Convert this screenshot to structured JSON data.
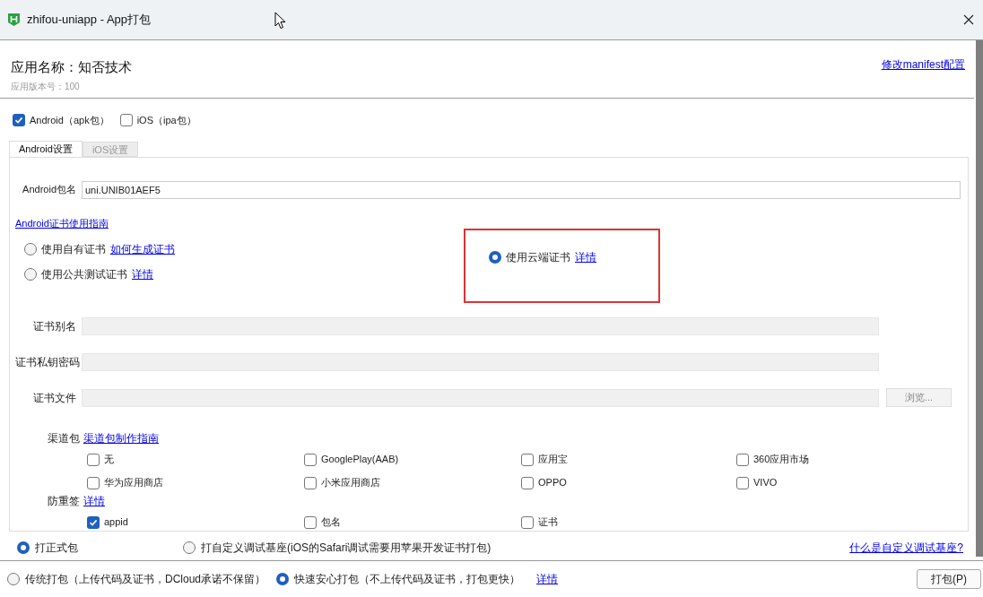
{
  "window": {
    "title": "zhifou-uniapp - App打包"
  },
  "header": {
    "app_name": "应用名称：知否技术",
    "version": "应用版本号：100",
    "manifest_link": "修改manifest配置"
  },
  "platforms": [
    {
      "label": "Android（apk包）",
      "checked": true
    },
    {
      "label": "iOS（ipa包）",
      "checked": false
    }
  ],
  "tabs": [
    {
      "label": "Android设置",
      "selected": true
    },
    {
      "label": "iOS设置",
      "selected": false
    }
  ],
  "android": {
    "package_label": "Android包名",
    "package_value": "uni.UNIB01AEF5",
    "cert_guide_link": "Android证书使用指南",
    "cert_options": [
      {
        "label": "使用自有证书",
        "link": "如何生成证书",
        "selected": false,
        "highlighted": false
      },
      {
        "label": "使用公共测试证书",
        "link": "详情",
        "selected": false,
        "highlighted": false
      },
      {
        "label": "使用云端证书",
        "link": "详情",
        "selected": true,
        "highlighted": true
      }
    ],
    "cert_fields": [
      {
        "label": "证书别名",
        "disabled": true
      },
      {
        "label": "证书私钥密码",
        "disabled": true
      },
      {
        "label": "证书文件",
        "disabled": true,
        "button": "浏览..."
      }
    ],
    "channel_label": "渠道包",
    "channel_link": "渠道包制作指南",
    "channels": [
      {
        "label": "无",
        "checked": false
      },
      {
        "label": "GooglePlay(AAB)",
        "checked": false
      },
      {
        "label": "应用宝",
        "checked": false
      },
      {
        "label": "360应用市场",
        "checked": false
      },
      {
        "label": "华为应用商店",
        "checked": false
      },
      {
        "label": "小米应用商店",
        "checked": false
      },
      {
        "label": "OPPO",
        "checked": false
      },
      {
        "label": "VIVO",
        "checked": false
      }
    ],
    "anti_label": "防重签",
    "anti_link": "详情",
    "anti": [
      {
        "label": "appid",
        "checked": true
      },
      {
        "label": "包名",
        "checked": false
      },
      {
        "label": "证书",
        "checked": false
      }
    ]
  },
  "build_types": [
    {
      "label": "打正式包",
      "selected": true
    },
    {
      "label": "打自定义调试基座(iOS的Safari调试需要用苹果开发证书打包)",
      "selected": false
    }
  ],
  "custom_base_link": "什么是自定义调试基座?",
  "pack_modes": [
    {
      "label": "传统打包（上传代码及证书，DCloud承诺不保留）",
      "selected": false
    },
    {
      "label": "快速安心打包（不上传代码及证书，打包更快）",
      "selected": true
    }
  ],
  "pack_link": "详情",
  "pack_button": "打包(P)"
}
